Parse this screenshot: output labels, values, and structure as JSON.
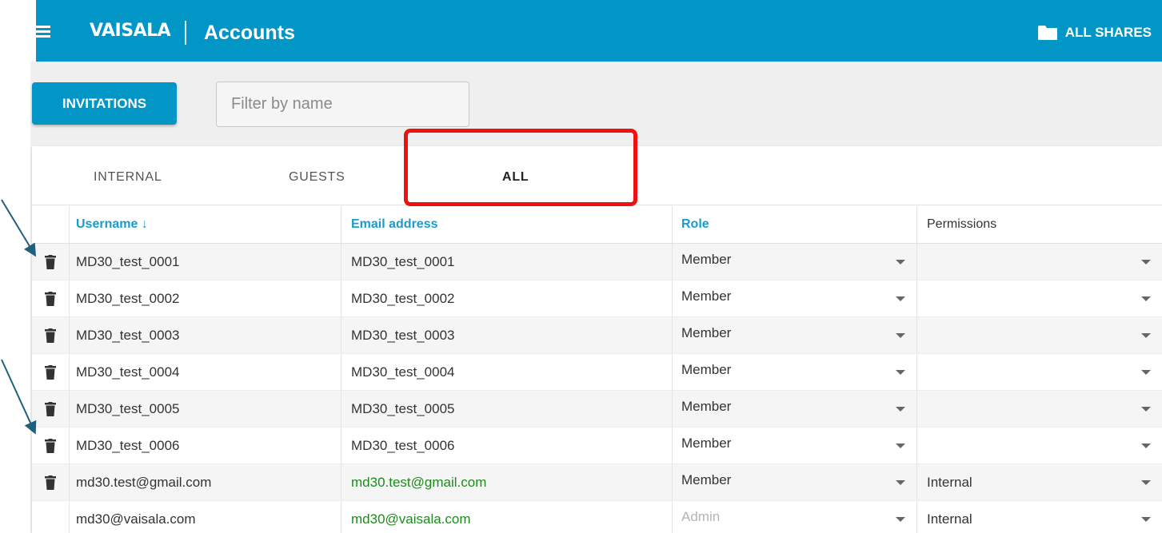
{
  "header": {
    "brand": "VAISALA",
    "title": "Accounts",
    "shares_label": "ALL SHARES",
    "menu_icon": "hamburger-menu-icon",
    "shares_icon": "folder-icon",
    "color": "#0196c6"
  },
  "toolbar": {
    "invitations_label": "INVITATIONS",
    "filter_placeholder": "Filter by name",
    "filter_value": ""
  },
  "tabs": [
    {
      "label": "INTERNAL",
      "active": false
    },
    {
      "label": "GUESTS",
      "active": false
    },
    {
      "label": "ALL",
      "active": true
    }
  ],
  "table": {
    "columns": [
      "Username ↓",
      "Email address",
      "Role",
      "Permissions"
    ],
    "rows": [
      {
        "username": "MD30_test_0001",
        "email": "MD30_test_0001",
        "role": "Member",
        "permissions": "",
        "deletable": true
      },
      {
        "username": "MD30_test_0002",
        "email": "MD30_test_0002",
        "role": "Member",
        "permissions": "",
        "deletable": true
      },
      {
        "username": "MD30_test_0003",
        "email": "MD30_test_0003",
        "role": "Member",
        "permissions": "",
        "deletable": true
      },
      {
        "username": "MD30_test_0004",
        "email": "MD30_test_0004",
        "role": "Member",
        "permissions": "",
        "deletable": true
      },
      {
        "username": "MD30_test_0005",
        "email": "MD30_test_0005",
        "role": "Member",
        "permissions": "",
        "deletable": true
      },
      {
        "username": "MD30_test_0006",
        "email": "MD30_test_0006",
        "role": "Member",
        "permissions": "",
        "deletable": true
      },
      {
        "username": "md30.test@gmail.com",
        "email": "md30.test@gmail.com",
        "role": "Member",
        "permissions": "Internal",
        "deletable": true
      },
      {
        "username": "md30@vaisala.com",
        "email": "md30@vaisala.com",
        "role": "Admin",
        "permissions": "Internal",
        "deletable": false
      }
    ]
  },
  "colors": {
    "accent": "#0196c6",
    "highlight": "#ee1111",
    "email_verified": "#1e8a1e",
    "annotation_arrow": "#1f5f7f"
  }
}
